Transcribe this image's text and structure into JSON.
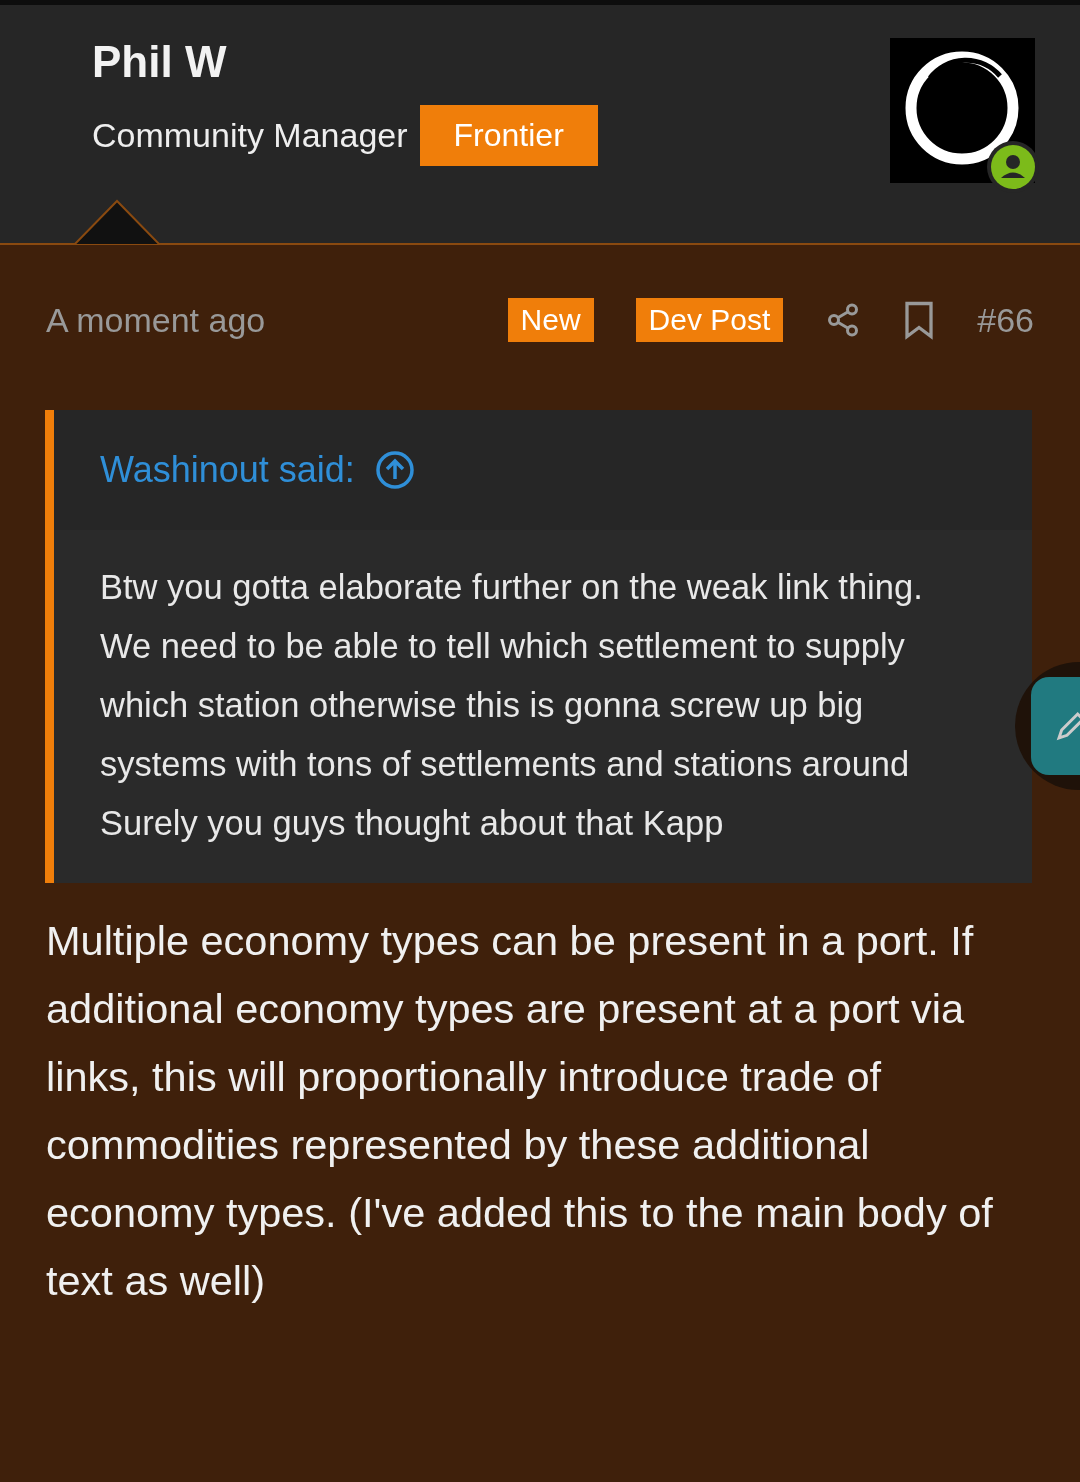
{
  "author": {
    "name": "Phil W",
    "role": "Community Manager",
    "badge": "Frontier",
    "online": true
  },
  "post": {
    "time": "A moment ago",
    "tags": [
      "New",
      "Dev Post"
    ],
    "number": "#66",
    "bookmarked": false
  },
  "quote": {
    "attribution": "Washinout said:",
    "paragraphs": [
      "Btw you gotta elaborate further on the weak link thing.",
      "We need to be able to tell which settlement to supply which station otherwise this is gonna screw up big systems with tons of settlements and stations around",
      "Surely you guys thought about that Kapp"
    ]
  },
  "body": "Multiple economy types can be present in a port. If additional economy types are present at a port via links, this will proportionally introduce trade of commodities represented by these additional economy types. (I've added this to the main body of text as well)"
}
